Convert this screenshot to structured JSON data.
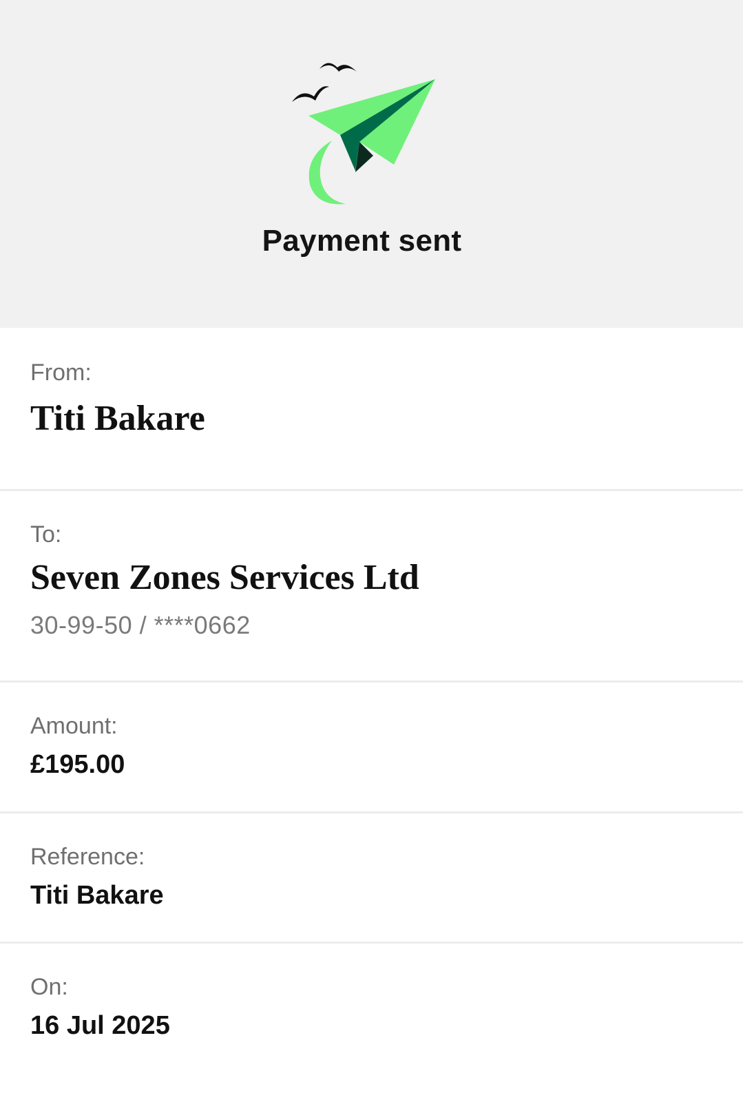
{
  "header": {
    "title": "Payment sent",
    "illustration": "paper-plane-sent-icon",
    "colors": {
      "background": "#f1f1f1",
      "plane_light": "#6ff07a",
      "plane_dark": "#006b49",
      "birds": "#111111"
    }
  },
  "details": {
    "from": {
      "label": "From:",
      "value": "Titi Bakare"
    },
    "to": {
      "label": "To:",
      "value": "Seven Zones Services Ltd",
      "account": "30-99-50 / ****0662"
    },
    "amount": {
      "label": "Amount:",
      "value": "£195.00"
    },
    "reference": {
      "label": "Reference:",
      "value": "Titi Bakare"
    },
    "on": {
      "label": "On:",
      "value": "16 Jul 2025"
    }
  }
}
